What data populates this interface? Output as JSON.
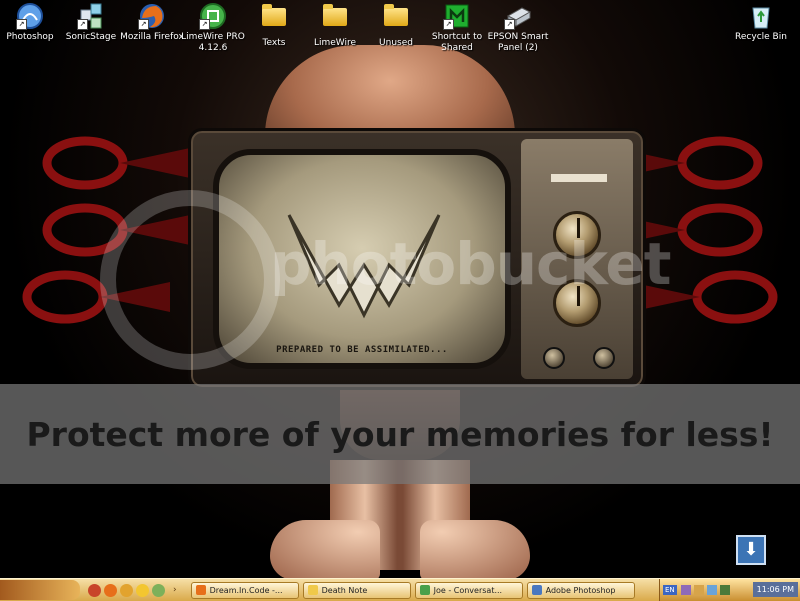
{
  "desktop": {
    "icons": [
      {
        "label": "Photoshop",
        "icon": "photoshop-icon",
        "shortcut": true
      },
      {
        "label": "SonicStage",
        "icon": "sonicstage-icon",
        "shortcut": true
      },
      {
        "label": "Mozilla Firefox",
        "icon": "firefox-icon",
        "shortcut": true
      },
      {
        "label": "LimeWire PRO 4.12.6",
        "icon": "limewire-icon",
        "shortcut": true
      },
      {
        "label": "Texts",
        "icon": "folder-icon",
        "shortcut": false
      },
      {
        "label": "LimeWire",
        "icon": "folder-icon",
        "shortcut": false
      },
      {
        "label": "Unused",
        "icon": "folder-icon",
        "shortcut": false
      },
      {
        "label": "Shortcut to Shared",
        "icon": "shared-shortcut-icon",
        "shortcut": true
      },
      {
        "label": "EPSON Smart Panel (2)",
        "icon": "epson-icon",
        "shortcut": true
      }
    ],
    "recycle_bin": {
      "label": "Recycle Bin",
      "icon": "recycle-bin-icon"
    }
  },
  "wallpaper": {
    "screen_text": "PREPARED TO BE ASSIMILATED..."
  },
  "watermark": {
    "brand": "photobucket",
    "banner": "Protect more of your memories for less!"
  },
  "taskbar": {
    "tasks": [
      {
        "label": "Dream.In.Code -...",
        "icon": "firefox-icon",
        "color": "#e76f1a"
      },
      {
        "label": "Death Note",
        "icon": "folder-icon",
        "color": "#f0c94a"
      },
      {
        "label": "Joe - Conversat...",
        "icon": "messenger-icon",
        "color": "#49a04a"
      },
      {
        "label": "Adobe Photoshop",
        "icon": "photoshop-icon",
        "color": "#4a78c0"
      }
    ],
    "tray": {
      "lang": "EN",
      "clock": "11:06 PM"
    }
  }
}
